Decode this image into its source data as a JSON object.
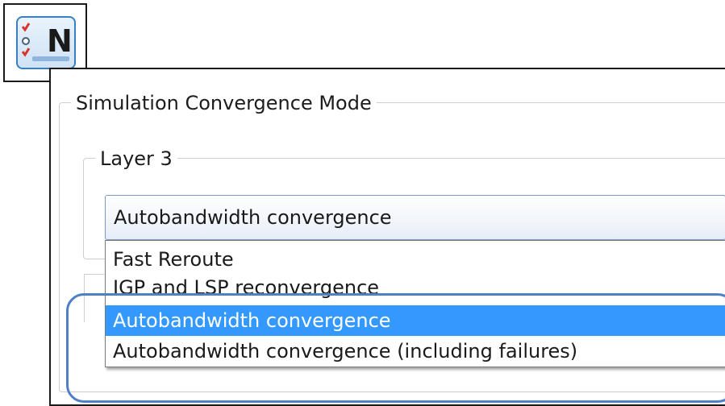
{
  "app_icon": {
    "glyph": "N",
    "icon": "network-checklist-icon",
    "accent": "#3a7fc0",
    "check_color": "#d9342b"
  },
  "outer_group": {
    "legend": "Simulation Convergence Mode"
  },
  "inner_group": {
    "legend": "Layer 3"
  },
  "combo": {
    "selected": "Autobandwidth convergence"
  },
  "dropdown": {
    "options": [
      "Fast Reroute",
      "IGP and LSP reconvergence",
      "Autobandwidth convergence",
      "Autobandwidth convergence (including failures)"
    ],
    "selected_index": 2,
    "selection_color": "#3399ff"
  },
  "highlight_color": "#4f7fc4"
}
